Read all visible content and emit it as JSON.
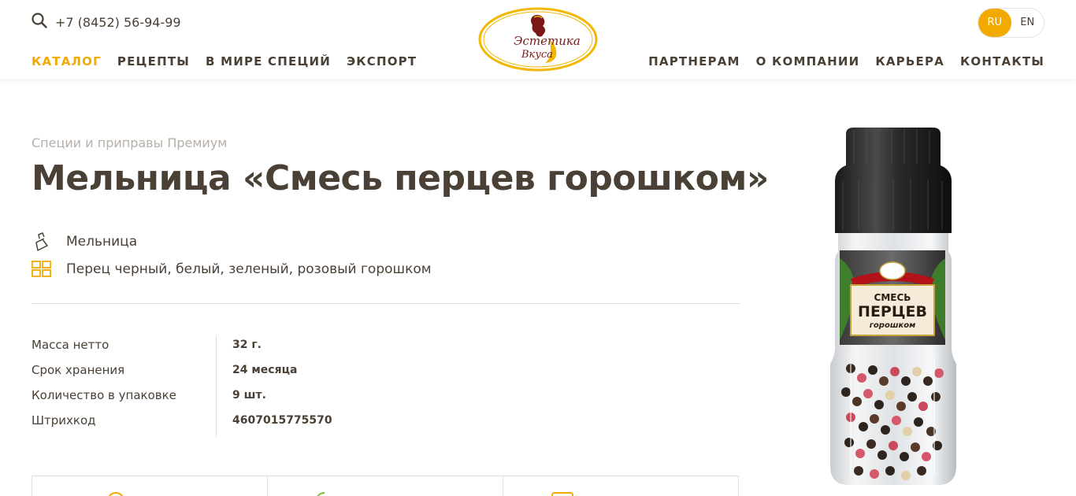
{
  "header": {
    "phone": "+7 (8452) 56-94-99",
    "logo": {
      "line1": "Эстетика",
      "line2": "Вкуса"
    },
    "lang": {
      "ru": "RU",
      "en": "EN",
      "active": "RU"
    },
    "nav_left": [
      "КАТАЛОГ",
      "РЕЦЕПТЫ",
      "В МИРЕ СПЕЦИЙ",
      "ЭКСПОРТ"
    ],
    "nav_right": [
      "ПАРТНЕРАМ",
      "О КОМПАНИИ",
      "КАРЬЕРА",
      "КОНТАКТЫ"
    ]
  },
  "product": {
    "breadcrumb": "Специи и приправы Премиум",
    "title": "Мельница «Смесь перцев горошком»",
    "features": [
      {
        "icon": "grinder-icon",
        "text": "Мельница"
      },
      {
        "icon": "grid-icon",
        "text": "Перец черный, белый, зеленый, розовый горошком"
      }
    ],
    "specs": [
      {
        "label": "Масса нетто",
        "value": "32 г."
      },
      {
        "label": "Срок хранения",
        "value": "24 месяца"
      },
      {
        "label": "Количество в упаковке",
        "value": "9 шт."
      },
      {
        "label": "Штрихкод",
        "value": "4607015775570"
      }
    ],
    "package_label": {
      "line1": "СМЕСЬ",
      "line2": "ПЕРЦЕВ",
      "line3": "горошком"
    }
  },
  "colors": {
    "accent": "#f2a900",
    "text": "#4a4035",
    "muted": "#b6b0a8"
  }
}
